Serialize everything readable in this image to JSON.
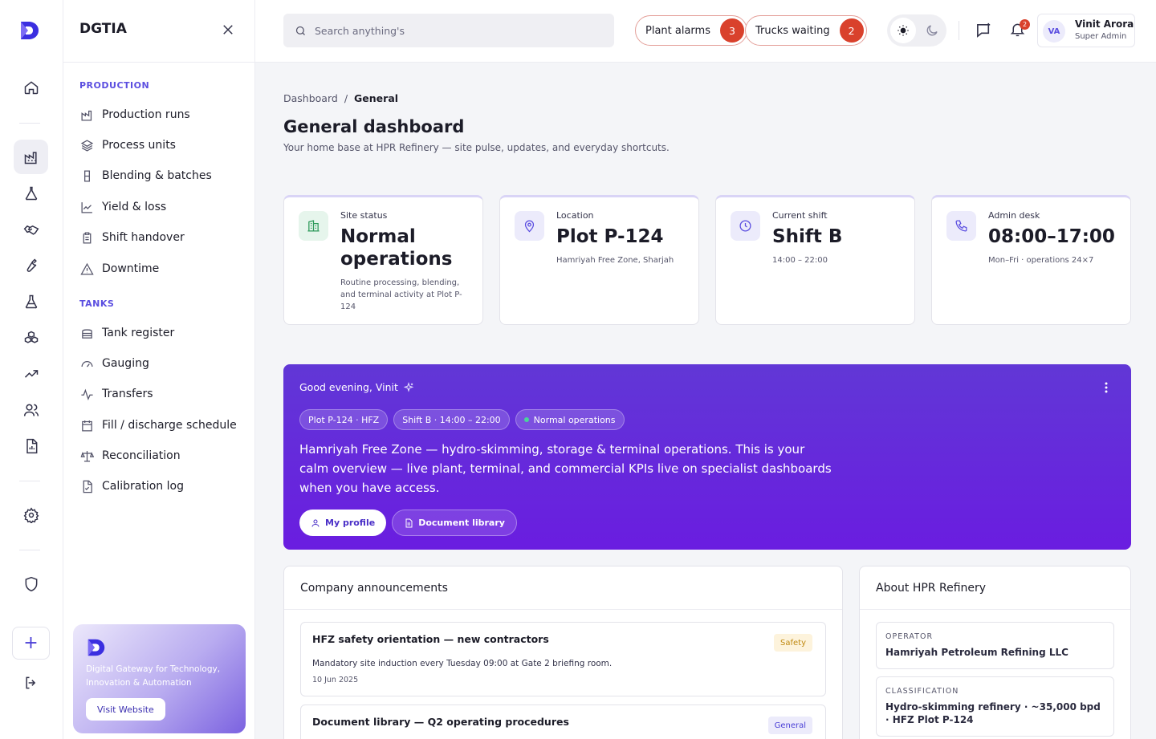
{
  "app": {
    "name": "DGTIA"
  },
  "sidebar": {
    "sections": [
      {
        "title": "PRODUCTION",
        "items": [
          {
            "label": "Production runs",
            "icon": "factory-icon"
          },
          {
            "label": "Process units",
            "icon": "layers-icon"
          },
          {
            "label": "Blending & batches",
            "icon": "cylinder-icon"
          },
          {
            "label": "Yield & loss",
            "icon": "line-chart-icon"
          },
          {
            "label": "Shift handover",
            "icon": "clipboard-icon"
          },
          {
            "label": "Downtime",
            "icon": "warning-icon"
          }
        ]
      },
      {
        "title": "TANKS",
        "items": [
          {
            "label": "Tank register",
            "icon": "tank-icon"
          },
          {
            "label": "Gauging",
            "icon": "gauge-icon"
          },
          {
            "label": "Transfers",
            "icon": "activity-icon"
          },
          {
            "label": "Fill / discharge schedule",
            "icon": "calendar-icon"
          },
          {
            "label": "Reconciliation",
            "icon": "scale-icon"
          },
          {
            "label": "Calibration log",
            "icon": "file-check-icon"
          }
        ]
      }
    ],
    "promo": {
      "text": "Digital Gateway for Technology, Innovation & Automation",
      "button": "Visit Website"
    }
  },
  "topbar": {
    "search_placeholder": "Search anything's",
    "alerts": [
      {
        "label": "Plant alarms",
        "count": "3"
      },
      {
        "label": "Trucks waiting",
        "count": "2"
      }
    ],
    "notifications_count": "2",
    "user": {
      "initials": "VA",
      "name": "Vinit Arora",
      "role": "Super Admin"
    }
  },
  "breadcrumb": {
    "parent": "Dashboard",
    "separator": "/",
    "current": "General"
  },
  "page": {
    "title": "General dashboard",
    "subtitle": "Your home base at HPR Refinery — site pulse, updates, and everyday shortcuts."
  },
  "stats": [
    {
      "label": "Site status",
      "value": "Normal operations",
      "note": "Routine processing, blending, and terminal activity at Plot P-124",
      "icon": "building-icon",
      "icon_bg": "#e6f5ec",
      "icon_color": "#2e9a5b"
    },
    {
      "label": "Location",
      "value": "Plot P-124",
      "note": "Hamriyah Free Zone, Sharjah",
      "icon": "map-pin-icon",
      "icon_bg": "#ecebfb",
      "icon_color": "#5b4ee0"
    },
    {
      "label": "Current shift",
      "value": "Shift B",
      "note": "14:00 – 22:00",
      "icon": "clock-icon",
      "icon_bg": "#ecebfb",
      "icon_color": "#5b4ee0"
    },
    {
      "label": "Admin desk",
      "value": "08:00–17:00",
      "note": "Mon–Fri · operations 24×7",
      "icon": "phone-icon",
      "icon_bg": "#ecebfb",
      "icon_color": "#5b4ee0"
    }
  ],
  "hero": {
    "greeting": "Good evening, Vinit",
    "tags": [
      "Plot P-124 · HFZ",
      "Shift B · 14:00 – 22:00",
      "Normal operations"
    ],
    "description": "Hamriyah Free Zone — hydro-skimming, storage & terminal operations. This is your calm overview — live plant, terminal, and commercial KPIs live on specialist dashboards when you have access.",
    "buttons": {
      "profile": "My profile",
      "docs": "Document library"
    }
  },
  "announcements": {
    "title": "Company announcements",
    "items": [
      {
        "title": "HFZ safety orientation — new contractors",
        "badge": "Safety",
        "body": "Mandatory site induction every Tuesday 09:00 at Gate 2 briefing room.",
        "date": "10 Jun 2025"
      },
      {
        "title": "Document library — Q2 operating procedures",
        "badge": "General"
      }
    ]
  },
  "about": {
    "title": "About HPR Refinery",
    "fields": [
      {
        "key": "OPERATOR",
        "value": "Hamriyah Petroleum Refining LLC"
      },
      {
        "key": "CLASSIFICATION",
        "value": "Hydro-skimming refinery · ~35,000 bpd · HFZ Plot P-124"
      }
    ]
  },
  "colors": {
    "accent": "#5b4ee0",
    "hero_start": "#6137d6",
    "hero_end": "#6a1de0",
    "alert": "#d9412c",
    "safety_badge_bg": "#fdf3dc",
    "safety_badge_fg": "#c08a12",
    "general_badge_bg": "#ecebfb",
    "general_badge_fg": "#4a3fd6"
  }
}
